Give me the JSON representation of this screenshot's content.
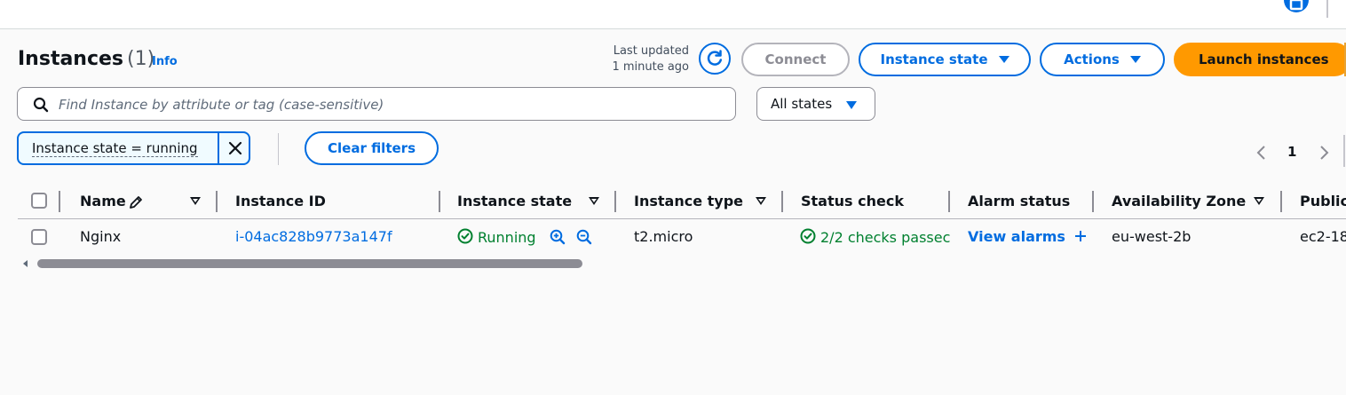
{
  "header": {
    "title": "Instances",
    "count": "(1)",
    "info": "Info",
    "last_updated_line1": "Last updated",
    "last_updated_line2": "1 minute ago"
  },
  "toolbar": {
    "connect": "Connect",
    "instance_state": "Instance state",
    "actions": "Actions",
    "launch": "Launch instances"
  },
  "search": {
    "placeholder": "Find Instance by attribute or tag (case-sensitive)",
    "value": ""
  },
  "state_filter": {
    "selected": "All states"
  },
  "filter_token": {
    "label": "Instance state = running",
    "clear": "Clear filters"
  },
  "pagination": {
    "current_page": "1"
  },
  "table": {
    "columns": [
      "Name",
      "Instance ID",
      "Instance state",
      "Instance type",
      "Status check",
      "Alarm status",
      "Availability Zone",
      "Public"
    ],
    "rows": [
      {
        "name": "Nginx",
        "instance_id": "i-04ac828b9773a147f",
        "state": "Running",
        "type": "t2.micro",
        "status_check": "2/2 checks passec",
        "alarm": "View alarms",
        "zone": "eu-west-2b",
        "public": "ec2-18"
      }
    ]
  },
  "colors": {
    "accent": "#006ce0",
    "launch": "#ff9900",
    "success": "#00802f"
  },
  "icons": {
    "refresh": "refresh-icon",
    "search": "search-icon",
    "close": "close-icon",
    "edit": "pencil-icon",
    "status": "check-circle-icon",
    "zoom_in": "zoom-in-icon",
    "zoom_out": "zoom-out-icon",
    "add": "plus-icon",
    "window": "window-icon"
  }
}
